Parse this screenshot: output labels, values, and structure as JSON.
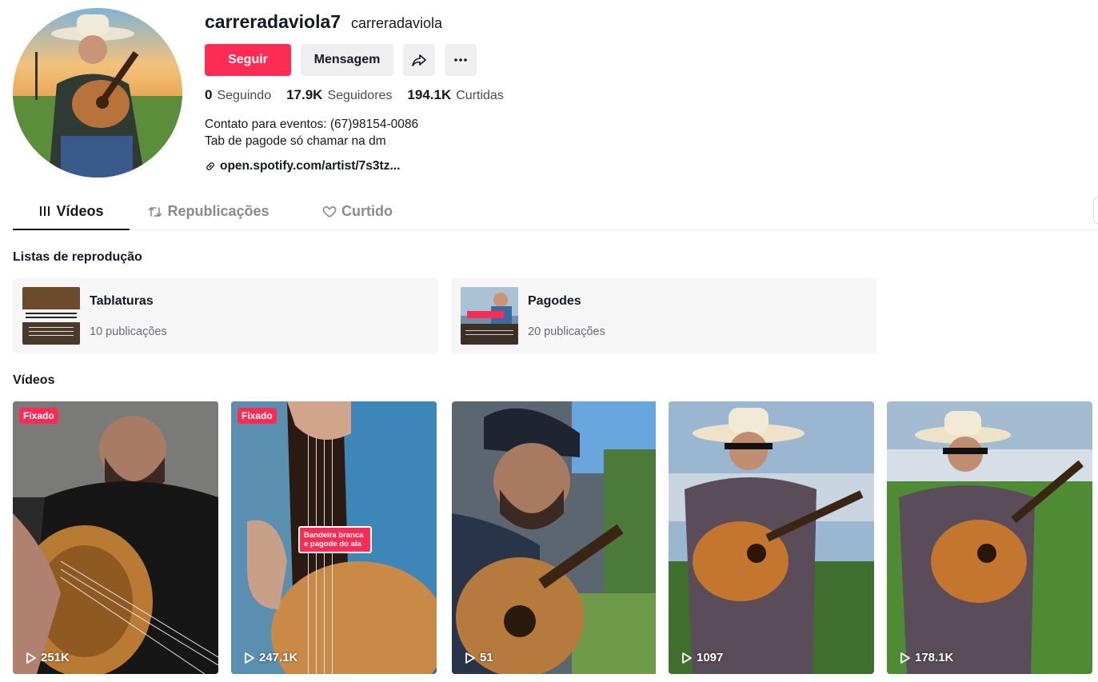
{
  "profile": {
    "username": "carreradaviola7",
    "nickname": "carreradaviola",
    "follow_label": "Seguir",
    "message_label": "Mensagem",
    "stats": [
      {
        "value": "0",
        "label": "Seguindo"
      },
      {
        "value": "17.9K",
        "label": "Seguidores"
      },
      {
        "value": "194.1K",
        "label": "Curtidas"
      }
    ],
    "bio_line1": "Contato para eventos: (67)98154-0086",
    "bio_line2": "Tab de pagode só chamar na dm",
    "link": "open.spotify.com/artist/7s3tz..."
  },
  "tabs": [
    {
      "label": "Vídeos",
      "icon": "grid-bars-icon",
      "active": true
    },
    {
      "label": "Republicações",
      "icon": "repost-icon",
      "active": false
    },
    {
      "label": "Curtido",
      "icon": "heart-outline-icon",
      "active": false
    }
  ],
  "playlists_title": "Listas de reprodução",
  "playlists": [
    {
      "name": "Tablaturas",
      "count": "10 publicações"
    },
    {
      "name": "Pagodes",
      "count": "20 publicações"
    }
  ],
  "videos_title": "Vídeos",
  "videos": [
    {
      "views": "251K",
      "pinned": "Fixado"
    },
    {
      "views": "247.1K",
      "pinned": "Fixado",
      "caption": "Bandeira branca e pagode do ala"
    },
    {
      "views": "51"
    },
    {
      "views": "1097"
    },
    {
      "views": "178.1K"
    }
  ],
  "colors": {
    "accent": "#fe2c55",
    "secondary_bg": "#efefef"
  }
}
